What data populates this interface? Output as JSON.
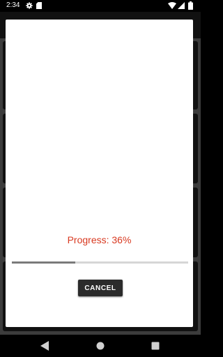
{
  "status_bar": {
    "time": "2:34",
    "icons": [
      "gear-icon",
      "sd-card-icon",
      "wifi-icon",
      "signal-icon",
      "battery-icon"
    ]
  },
  "dialog": {
    "progress_label": "Progress: 36%",
    "progress_fraction": 0.36,
    "cancel_label": "CANCEL"
  },
  "colors": {
    "progress_text": "#d8381f",
    "progress_fill": "#7a7a7a",
    "progress_track": "#d6d6d6",
    "button_bg": "#2b2b2b"
  },
  "nav_bar": {
    "icons": [
      "back-icon",
      "home-icon",
      "recents-icon"
    ]
  }
}
